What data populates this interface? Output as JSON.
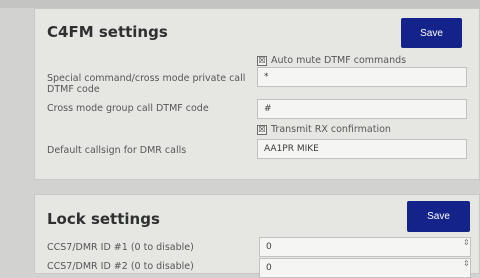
{
  "c4fm": {
    "title": "C4FM settings",
    "save_label": "Save",
    "auto_mute_label": "Auto mute DTMF commands",
    "auto_mute_check": "☒",
    "special_label": "Special command/cross mode private call DTMF code",
    "special_value": "*",
    "group_label": "Cross mode group call DTMF code",
    "group_value": "#",
    "transmit_label": "Transmit RX confirmation",
    "transmit_check": "☒",
    "callsign_label": "Default callsign for DMR calls",
    "callsign_value": "AA1PR MIKE"
  },
  "lock": {
    "title": "Lock settings",
    "save_label": "Save",
    "row1_label": "CCS7/DMR ID #1 (0 to disable)",
    "row1_value": "0",
    "row2_label": "CCS7/DMR ID #2 (0 to disable)",
    "row2_value": "0"
  }
}
